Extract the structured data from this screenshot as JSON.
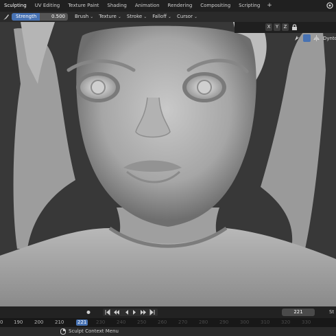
{
  "workspaces": [
    {
      "label": "Sculpting",
      "active": true
    },
    {
      "label": "UV Editing"
    },
    {
      "label": "Texture Paint"
    },
    {
      "label": "Shading"
    },
    {
      "label": "Animation"
    },
    {
      "label": "Rendering"
    },
    {
      "label": "Compositing"
    },
    {
      "label": "Scripting"
    }
  ],
  "add_workspace": "+",
  "toolbar": {
    "strength_label": "Strength",
    "strength_value": "0.500",
    "strength_fraction": 0.5,
    "menus": [
      "Brush",
      "Texture",
      "Stroke",
      "Falloff",
      "Cursor"
    ]
  },
  "viewport": {
    "mirror_axes": [
      "X",
      "Y",
      "Z"
    ],
    "dyntopo_label": "Dyntopo",
    "icons": [
      "sculpt-brush-icon",
      "mirror-icon",
      "snap-icon",
      "overlay-icon",
      "scene-icon"
    ]
  },
  "timeline": {
    "current_frame": "221",
    "frame_field": "221",
    "ticks": [
      "0",
      "190",
      "200",
      "210",
      "220",
      "230",
      "240",
      "250",
      "260",
      "270",
      "280",
      "290",
      "300",
      "310",
      "320",
      "330"
    ],
    "end_label": "St"
  },
  "status": {
    "context_menu": "Sculpt Context Menu"
  },
  "colors": {
    "accent": "#4772b3",
    "header_bg": "#202020",
    "viewport_bg": "#393939"
  }
}
